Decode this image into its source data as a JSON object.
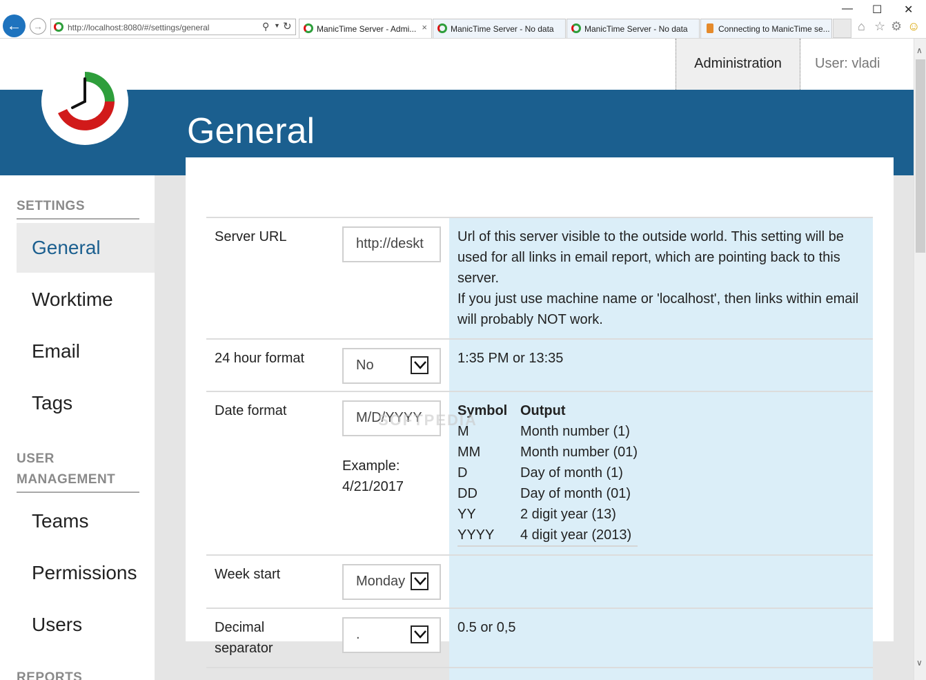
{
  "browser": {
    "address": "http://localhost:8080/#/settings/general",
    "tabs": [
      {
        "label": "ManicTime Server - Admi...",
        "active": true
      },
      {
        "label": "ManicTime Server - No data",
        "active": false
      },
      {
        "label": "ManicTime Server - No data",
        "active": false
      },
      {
        "label": "Connecting to ManicTime se...",
        "active": false
      }
    ],
    "tab_close": "×",
    "window_controls": {
      "minimize": "—",
      "maximize": "☐",
      "close": "✕"
    }
  },
  "nav": {
    "admin_label": "Administration",
    "user_label": "User: vladi"
  },
  "header": {
    "title": "General"
  },
  "sidebar": {
    "settings_heading": "SETTINGS",
    "settings_items": [
      "General",
      "Worktime",
      "Email",
      "Tags"
    ],
    "user_mgmt_heading": "USER MANAGEMENT",
    "user_mgmt_items": [
      "Teams",
      "Permissions",
      "Users"
    ],
    "reports_heading": "REPORTS",
    "active_item": "General"
  },
  "settings": {
    "server_url": {
      "label": "Server URL",
      "value": "http://deskt",
      "desc_line1": "Url of this server visible to the outside world. This setting will be used for all links in email report, which are pointing back to this server.",
      "desc_line2": "If you just use machine name or 'localhost', then links within email will probably NOT work."
    },
    "hour_format": {
      "label": "24 hour format",
      "value": "No",
      "desc": "1:35 PM or 13:35"
    },
    "date_format": {
      "label": "Date format",
      "value": "M/D/YYYY",
      "example_label": "Example:",
      "example_value": "4/21/2017",
      "table_headers": [
        "Symbol",
        "Output"
      ],
      "table_rows": [
        [
          "M",
          "Month number (1)"
        ],
        [
          "MM",
          "Month number (01)"
        ],
        [
          "D",
          "Day of month (1)"
        ],
        [
          "DD",
          "Day of month (01)"
        ],
        [
          "YY",
          "2 digit year (13)"
        ],
        [
          "YYYY",
          "4 digit year (2013)"
        ]
      ]
    },
    "week_start": {
      "label": "Week start",
      "value": "Monday"
    },
    "decimal_separator": {
      "label": "Decimal separator",
      "value": ".",
      "desc": "0.5 or 0,5"
    }
  },
  "watermark": "SOFTPEDIA",
  "colors": {
    "header_band": "#1b5f8f",
    "description_bg": "#dbeef8",
    "active_sidebar_text": "#1b5f8f"
  }
}
